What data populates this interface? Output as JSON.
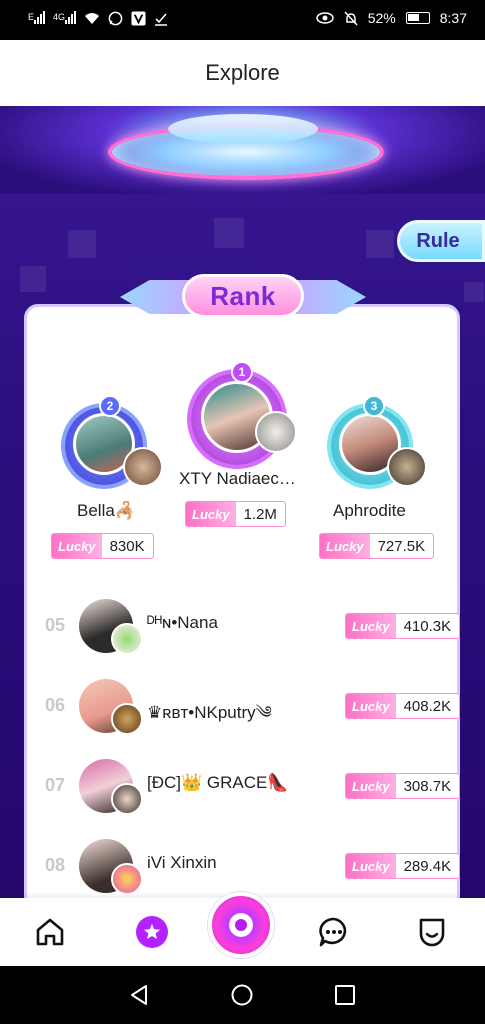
{
  "status_bar": {
    "net1": "E",
    "net2": "4G",
    "battery_text": "52%",
    "time": "8:37"
  },
  "header": {
    "title": "Explore"
  },
  "rule_label": "Rule",
  "rank_label": "Rank",
  "lucky_label": "Lucky",
  "podium": [
    {
      "rank": "2",
      "name": "Bella🦂",
      "score": "830K"
    },
    {
      "rank": "1",
      "name": "XTY Nadiaec…",
      "score": "1.2M"
    },
    {
      "rank": "3",
      "name": "Aphrodite",
      "score": "727.5K"
    }
  ],
  "list": [
    {
      "rank": "05",
      "name": "ᴰᴴɴ•Nana",
      "score": "410.3K"
    },
    {
      "rank": "06",
      "name": "♛ʀʙᴛ•NKputry༄",
      "score": "408.2K"
    },
    {
      "rank": "07",
      "name": "[ÐC]👑 GRACE👠",
      "score": "308.7K"
    },
    {
      "rank": "08",
      "name": "iVi Xinxin",
      "score": "289.4K"
    }
  ],
  "colors": {
    "accent": "#b322ff",
    "lucky": "#ff6fc8",
    "gold_badge": "#c04bff",
    "silver_badge": "#5a6bff",
    "bronze_badge": "#3fb8d4"
  }
}
